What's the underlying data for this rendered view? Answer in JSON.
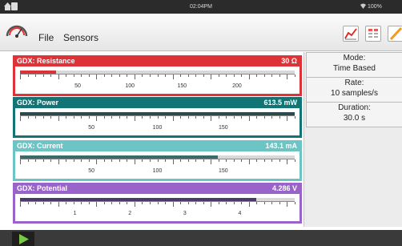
{
  "status_bar": {
    "time": "02:04PM",
    "battery": "100%"
  },
  "menu": {
    "file": "File",
    "sensors": "Sensors"
  },
  "colors": {
    "resistance": "#dd3237",
    "power": "#117575",
    "current": "#6dc4c4",
    "potential": "#9a63c9",
    "play": "#7ac943"
  },
  "gauges": [
    {
      "name": "GDX: Resistance",
      "value": "30 Ω",
      "level": 0.13,
      "ticks": [
        "50",
        "100",
        "150",
        "200"
      ]
    },
    {
      "name": "GDX: Power",
      "value": "613.5 mW",
      "level": 1.0,
      "ticks": [
        "50",
        "100",
        "150"
      ]
    },
    {
      "name": "GDX: Current",
      "value": "143.1 mA",
      "level": 0.72,
      "ticks": [
        "50",
        "100",
        "150"
      ]
    },
    {
      "name": "GDX: Potential",
      "value": "4.286 V",
      "level": 0.86,
      "ticks": [
        "1",
        "2",
        "3",
        "4"
      ]
    }
  ],
  "info_panel": {
    "mode": {
      "label": "Mode:",
      "value": "Time Based"
    },
    "rate": {
      "label": "Rate:",
      "value": "10 samples/s"
    },
    "duration": {
      "label": "Duration:",
      "value": "30.0 s"
    }
  }
}
